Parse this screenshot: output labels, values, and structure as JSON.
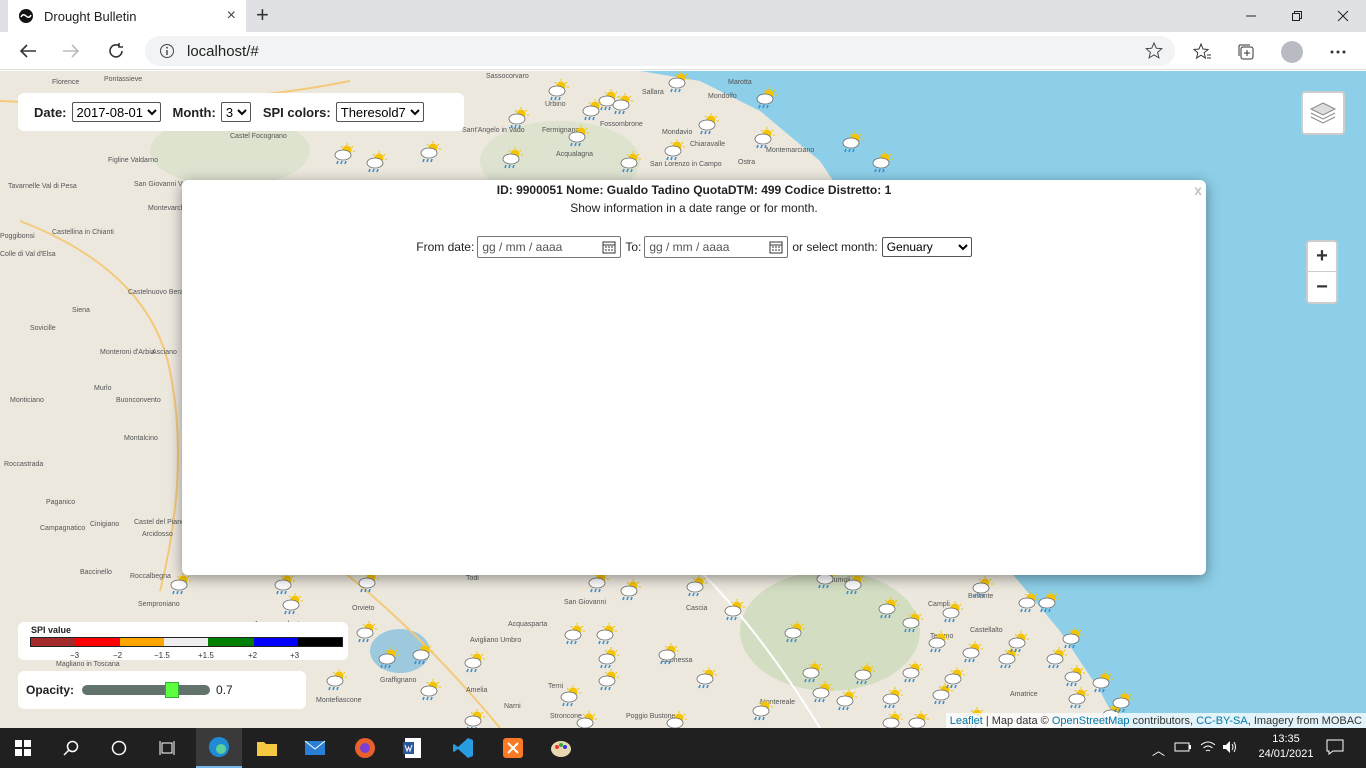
{
  "browser": {
    "tab_title": "Drought Bulletin",
    "tab_close": "×",
    "new_tab": "+",
    "url": "localhost/#",
    "window_controls": [
      "minimize-icon",
      "restore-icon",
      "close-icon"
    ]
  },
  "controls": {
    "date_label": "Date:",
    "date_value": "2017-08-01",
    "month_label": "Month:",
    "month_value": "3",
    "spi_label": "SPI colors:",
    "spi_value": "Theresold7"
  },
  "zoom": {
    "in": "+",
    "out": "−"
  },
  "popup": {
    "close": "x",
    "title": "ID: 9900051 Nome: Gualdo Tadino QuotaDTM: 499 Codice Distretto: 1",
    "subtitle": "Show information in a date range or for month.",
    "from_label": "From date:",
    "from_placeholder": "gg / mm / aaaa",
    "to_label": "To:",
    "to_placeholder": "gg / mm / aaaa",
    "month_label": "or select month:",
    "month_value": "Genuary"
  },
  "legend": {
    "title": "SPI value",
    "colors": [
      "#a52a2a",
      "#ff0000",
      "#ffa500",
      "#eeeeee",
      "#008000",
      "#0000ff",
      "#000000"
    ],
    "ticks": [
      "−3",
      "−2",
      "−1.5",
      "+1.5",
      "+2",
      "+3"
    ]
  },
  "opacity": {
    "label": "Opacity:",
    "value": "0.7",
    "fraction": 0.7
  },
  "attribution": {
    "leaflet": "Leaflet",
    "sep": "| Map data ©",
    "osm": "OpenStreetMap",
    "contrib": "contributors,",
    "license": "CC-BY-SA",
    "imagery": ", Imagery from MOBAC"
  },
  "map_labels": [
    "Florence",
    "Pontassieve",
    "Figline Valdarno",
    "San Giovanni Valdarno",
    "Tavarnelle Val di Pesa",
    "Montevarchi",
    "Castellina in Chianti",
    "Poggibonsi",
    "Colle di Val d'Elsa",
    "Castelnuovo Berardenga",
    "Siena",
    "Sovicille",
    "Monteroni d'Arbia",
    "Asciano",
    "Murlo",
    "Buonconvento",
    "Monticiano",
    "Montalcino",
    "Roccastrada",
    "Paganico",
    "Cinigiano",
    "Campagnatico",
    "Castel del Piano",
    "Arcidosso",
    "Roccalbegna",
    "Baccinello",
    "Semproniano",
    "Sassocorvaro",
    "Urbino",
    "Fossombrone",
    "Sant'Angelo in Vado",
    "Fermignano",
    "Acqualagna",
    "Sallara",
    "Mondolfo",
    "Marotta",
    "Montemarciano",
    "Ostra",
    "Chiaravalle",
    "Mondavio",
    "San Lorenzo in Campo",
    "Castel Focognano",
    "Orvieto",
    "Todi",
    "San Giovanni",
    "Acquasparta",
    "Avigliano Umbro",
    "Amelia",
    "Narni",
    "Terni",
    "Stroncone",
    "Leonessa",
    "Montereale",
    "Accumoli",
    "Cascia",
    "Teramo",
    "Campli",
    "Castellalto",
    "Bellante",
    "Montefiascone",
    "Graffignano",
    "Magliano in Toscana",
    "Acquapendente",
    "Amatrice",
    "Poggio Bustone"
  ],
  "taskbar": {
    "apps": [
      "start-icon",
      "search-icon",
      "cortana-icon",
      "task-view-icon",
      "edge-icon",
      "explorer-icon",
      "mail-icon",
      "firefox-icon",
      "word-icon",
      "vscode-icon",
      "xampp-icon",
      "paint-icon"
    ],
    "time": "13:35",
    "date": "24/01/2021"
  }
}
